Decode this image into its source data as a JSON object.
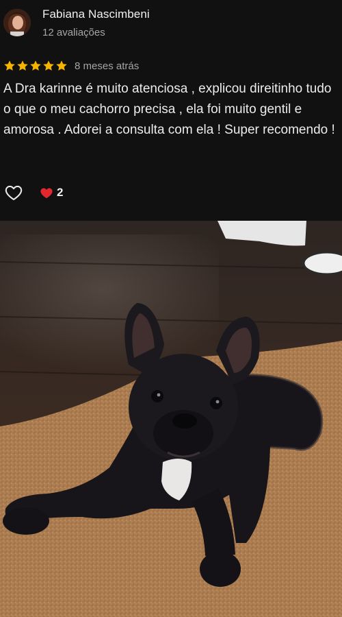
{
  "reviewer": {
    "name": "Fabiana Nascimbeni",
    "review_count": "12 avaliações"
  },
  "review": {
    "rating": 5,
    "max_rating": 5,
    "time_ago": "8 meses atrás",
    "text": "A Dra karinne é muito atenciosa , explicou direitinho tudo o que o meu cachorro precisa , ela foi muito gentil e amorosa . Adorei a consulta com ela ! Super recomendo !"
  },
  "reactions": {
    "like_icon": "heart-outline-icon",
    "reaction_icon": "red-heart-icon",
    "count": "2"
  },
  "photo": {
    "subject": "black french bulldog lying on a rug"
  },
  "colors": {
    "background": "#111111",
    "star": "#f5b400",
    "heart": "#e0282e"
  }
}
